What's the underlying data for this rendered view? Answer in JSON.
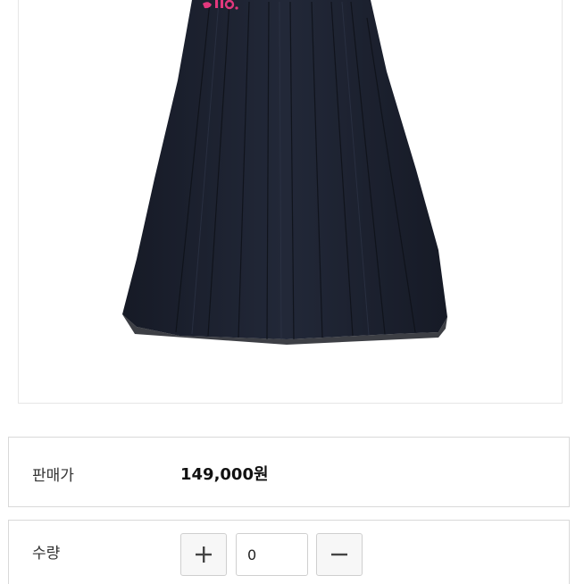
{
  "product": {
    "image_icon": "pleated-skirt-image",
    "skirt_color": "#1d2230",
    "logo_color": "#e3387d"
  },
  "price_row": {
    "label": "판매가",
    "value": "149,000원"
  },
  "quantity_row": {
    "label": "수량",
    "value": "0",
    "increase_icon": "plus-icon",
    "decrease_icon": "minus-icon"
  }
}
